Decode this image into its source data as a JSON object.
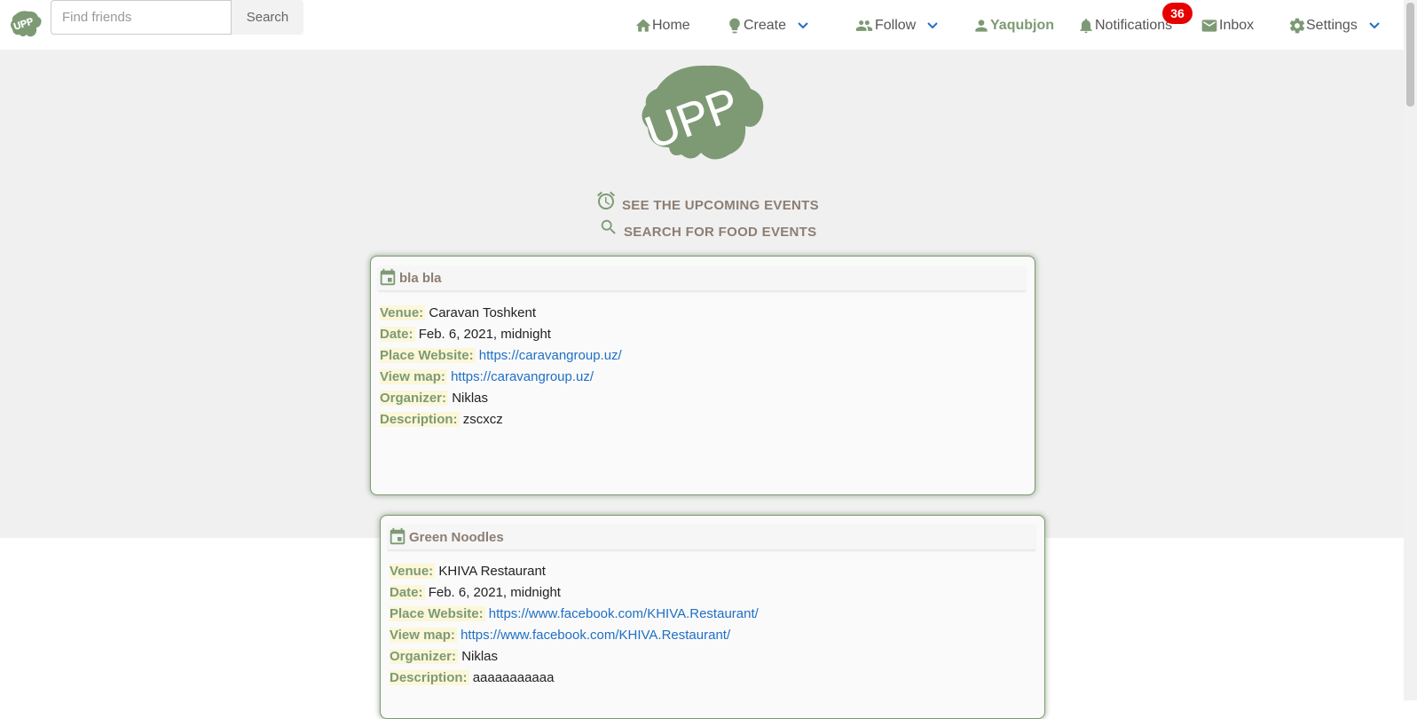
{
  "navbar": {
    "search": {
      "placeholder": "Find friends",
      "button": "Search"
    },
    "items": [
      {
        "label": "Home",
        "icon": "home-icon"
      },
      {
        "label": "Create",
        "icon": "lightbulb-icon"
      },
      {
        "label": "Follow",
        "icon": "people-icon"
      },
      {
        "label": "Yaqubjon",
        "icon": "person-icon"
      },
      {
        "label": "Notifications",
        "icon": "bell-icon"
      },
      {
        "label": "Inbox",
        "icon": "mail-icon"
      },
      {
        "label": "Settings",
        "icon": "gear-icon"
      }
    ],
    "notification_count": "36"
  },
  "hero": {
    "logo_text": "UPP",
    "links": [
      {
        "label": "SEE THE UPCOMING EVENTS",
        "icon": "alarm-clock-icon"
      },
      {
        "label": "SEARCH FOR FOOD EVENTS",
        "icon": "search-icon"
      }
    ]
  },
  "field_labels": {
    "venue": "Venue:",
    "date": "Date:",
    "website": "Place Website:",
    "map": "View map:",
    "organizer": "Organizer:",
    "description": "Description:"
  },
  "events": [
    {
      "title": "bla bla",
      "venue": "Caravan Toshkent",
      "date": "Feb. 6, 2021, midnight",
      "website": "https://caravangroup.uz/",
      "map": "https://caravangroup.uz/",
      "organizer": "Niklas",
      "description": "zscxcz"
    },
    {
      "title": "Green Noodles",
      "venue": "KHIVA Restaurant",
      "date": "Feb. 6, 2021, midnight",
      "website": "https://www.facebook.com/KHIVA.Restaurant/",
      "map": "https://www.facebook.com/KHIVA.Restaurant/",
      "organizer": "Niklas",
      "description": "aaaaaaaaaaa"
    }
  ],
  "colors": {
    "brand_green": "#7d9a74",
    "title_brown": "#8d7d72",
    "link_blue": "#1f6fc5",
    "badge_red": "#e60000",
    "label_highlight": "#fbf7d8"
  }
}
